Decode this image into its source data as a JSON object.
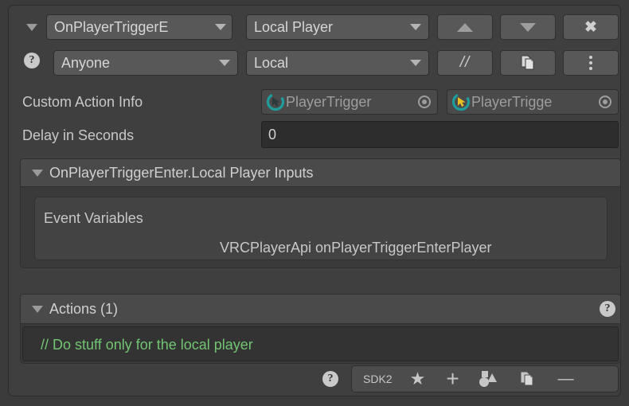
{
  "window": {
    "background_color": "#3b3b3b",
    "panel_color": "#3f3f3f"
  },
  "event_row": {
    "foldout_icon": "triangle-down-icon",
    "event_dropdown": {
      "value": "OnPlayerTriggerE",
      "full_value": "OnPlayerTriggerEnter",
      "icon": "chevron-down-icon"
    },
    "target_dropdown": {
      "value": "Local Player",
      "icon": "chevron-down-icon"
    },
    "move_up_button": {
      "icon": "triangle-up-icon",
      "label": ""
    },
    "move_down_button": {
      "icon": "triangle-down-icon",
      "label": ""
    },
    "delete_button": {
      "icon": "close-x-icon",
      "label": "✖"
    }
  },
  "filter_row": {
    "help_icon": "help-question-icon",
    "who_dropdown": {
      "value": "Anyone",
      "icon": "chevron-down-icon"
    },
    "scope_dropdown": {
      "value": "Local",
      "icon": "chevron-down-icon"
    },
    "comment_button": {
      "label": "//",
      "icon": "comment-slashes-icon"
    },
    "copy_button": {
      "icon": "copy-pages-icon",
      "label": ""
    },
    "menu_button": {
      "icon": "kebab-menu-icon",
      "label": ""
    }
  },
  "custom_action_info": {
    "label": "Custom Action Info",
    "object_field_1": {
      "name": "PlayerTrigger",
      "icon": "vrc-trigger-teal-icon",
      "picker_icon": "object-picker-dot-icon",
      "icon_color": "#1f9c9c"
    },
    "object_field_2": {
      "name": "PlayerTrigge",
      "icon": "vrc-trigger-yellow-icon",
      "picker_icon": "object-picker-dot-icon",
      "icon_color": "#1f9c9c",
      "cursor_color": "#e8c022"
    }
  },
  "delay": {
    "label": "Delay in Seconds",
    "value": "0",
    "placeholder": "0"
  },
  "inputs_section": {
    "foldout_icon": "triangle-down-icon",
    "title": "OnPlayerTriggerEnter.Local Player Inputs",
    "event_variables_label": "Event Variables",
    "variable_entry": "VRCPlayerApi onPlayerTriggerEnterPlayer"
  },
  "actions_section": {
    "foldout_icon": "triangle-down-icon",
    "title": "Actions (1)",
    "help_icon": "help-question-icon",
    "items": [
      {
        "text": "// Do stuff only for the local player",
        "color": "#72c572"
      }
    ]
  },
  "actions_toolbar": {
    "help_icon": "help-question-icon",
    "sdk_label": "SDK2",
    "favorite_button": {
      "icon": "star-icon",
      "label": "★"
    },
    "add_button": {
      "icon": "plus-icon",
      "label": "+"
    },
    "shapes_button": {
      "icon": "shapes-icon",
      "label": ""
    },
    "duplicate_button": {
      "icon": "copy-pages-icon",
      "label": ""
    },
    "remove_button": {
      "icon": "minus-icon",
      "label": "—"
    }
  }
}
